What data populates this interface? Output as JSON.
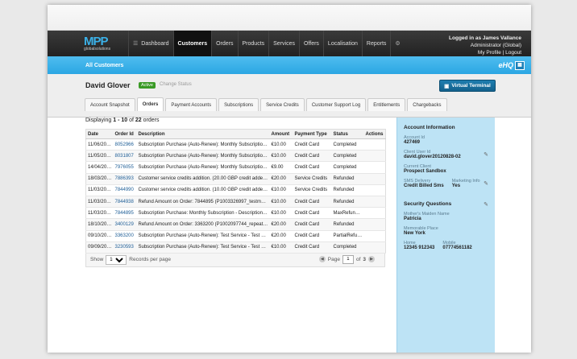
{
  "nav": {
    "logo_big": "MPP",
    "logo_small": "globalsolutions",
    "items": [
      {
        "label": "Dashboard",
        "icon": "grid-icon"
      },
      {
        "label": "Customers",
        "active": true
      },
      {
        "label": "Orders"
      },
      {
        "label": "Products"
      },
      {
        "label": "Services"
      },
      {
        "label": "Offers"
      },
      {
        "label": "Localisation"
      },
      {
        "label": "Reports"
      },
      {
        "label": "",
        "icon": "gear-icon"
      }
    ],
    "user": {
      "logged_in": "Logged in as James Vallance",
      "role": "Administrator (Global)",
      "links": "My Profile | Logout"
    }
  },
  "bluebar": {
    "title": "All Customers",
    "ehq": "eHQ"
  },
  "customer": {
    "name": "David Glover",
    "status": "Active",
    "change_status": "Change Status",
    "terminal_button": "Virtual Terminal"
  },
  "tabs": [
    "Account Snapshot",
    "Orders",
    "Payment Accounts",
    "Subscriptions",
    "Service Credits",
    "Customer Support Log",
    "Entitlements",
    "Chargebacks"
  ],
  "orders": {
    "displaying": "Displaying",
    "range": "1 - 10",
    "of": "of",
    "total": "22",
    "suffix": "orders",
    "columns": [
      "Date",
      "Order Id",
      "Description",
      "Amount",
      "Payment Type",
      "Status",
      "Actions"
    ],
    "rows": [
      [
        "11/06/2014",
        "8052966",
        "Subscription Purchase (Auto-Renew): Monthly Subscription - ...",
        "€10.00",
        "Credit Card",
        "Completed",
        ""
      ],
      [
        "11/05/2014",
        "8031807",
        "Subscription Purchase (Auto-Renew): Monthly Subscription - ...",
        "€10.00",
        "Credit Card",
        "Completed",
        ""
      ],
      [
        "14/04/2014",
        "7976055",
        "Subscription Purchase (Auto-Renew): Monthly Subscription - ...",
        "€9.00",
        "Credit Card",
        "Completed",
        ""
      ],
      [
        "18/03/2014",
        "7886393",
        "Customer service credits addition. (20.00 GBP credit added t...",
        "€20.00",
        "Service Credits",
        "Refunded",
        ""
      ],
      [
        "11/03/2014",
        "7844990",
        "Customer service credits addition. (10.00 GBP credit added t...",
        "€10.00",
        "Service Credits",
        "Refunded",
        ""
      ],
      [
        "11/03/2014",
        "7844938",
        "Refund Amount on Order: 7844895 (P1003326997_testmode)",
        "€10.00",
        "Credit Card",
        "Refunded",
        ""
      ],
      [
        "11/03/2014",
        "7844895",
        "Subscription Purchase: Monthly Subscription - Description (N...",
        "€10.00",
        "Credit Card",
        "MaxRefunded",
        ""
      ],
      [
        "18/10/2013",
        "3400129",
        "Refund Amount on Order: 3363200 (P1002097744_repeat_te...",
        "€20.00",
        "Credit Card",
        "Refunded",
        ""
      ],
      [
        "09/10/2013",
        "3363200",
        "Subscription Purchase (Auto-Renew): Test Service - Test Se...",
        "€20.00",
        "Credit Card",
        "PartialRefunded",
        ""
      ],
      [
        "09/09/2013",
        "3230593",
        "Subscription Purchase (Auto-Renew): Test Service - Test Se...",
        "€10.00",
        "Credit Card",
        "Completed",
        ""
      ]
    ]
  },
  "pager": {
    "show": "Show",
    "per_page_value": "10",
    "records_per_page": "Records per page",
    "page": "Page",
    "current": "1",
    "of": "of",
    "total_pages": "3"
  },
  "account": {
    "title": "Account Information",
    "user_id_label": "Account Id",
    "user_id": "427469",
    "client_user_label": "Client User Id",
    "client_user": "david.glover20120828-02",
    "current_client_label": "Current Client",
    "current_client": "Prospect Sandbox",
    "sms_label": "SMS Delivery",
    "sms": "Credit Billed Sms",
    "marketing_label": "Marketing Info",
    "marketing": "Yes"
  },
  "security": {
    "title": "Security Questions",
    "maiden_label": "Mother's Maiden Name",
    "maiden": "Patricia",
    "place_label": "Memorable Place",
    "place": "New York",
    "home_label": "Home",
    "home": "12345 912343",
    "mobile_label": "Mobile",
    "mobile": "07774561182"
  }
}
